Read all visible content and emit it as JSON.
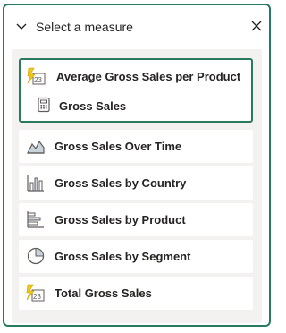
{
  "header": {
    "title": "Select a measure"
  },
  "measures": {
    "selected_group": {
      "parent_label": "Average Gross Sales per Product",
      "child_label": "Gross Sales"
    },
    "items": [
      {
        "label": "Gross Sales Over Time",
        "icon": "area-chart-icon"
      },
      {
        "label": "Gross Sales by Country",
        "icon": "column-chart-icon"
      },
      {
        "label": "Gross Sales by Product",
        "icon": "bar-chart-icon"
      },
      {
        "label": "Gross Sales by Segment",
        "icon": "pie-chart-icon"
      },
      {
        "label": "Total Gross Sales",
        "icon": "measure-icon"
      }
    ]
  },
  "colors": {
    "accent": "#2a7a5e",
    "list_background": "#f3f2f1",
    "icon_yellow": "#f2c811",
    "icon_gray": "#605e5c"
  }
}
